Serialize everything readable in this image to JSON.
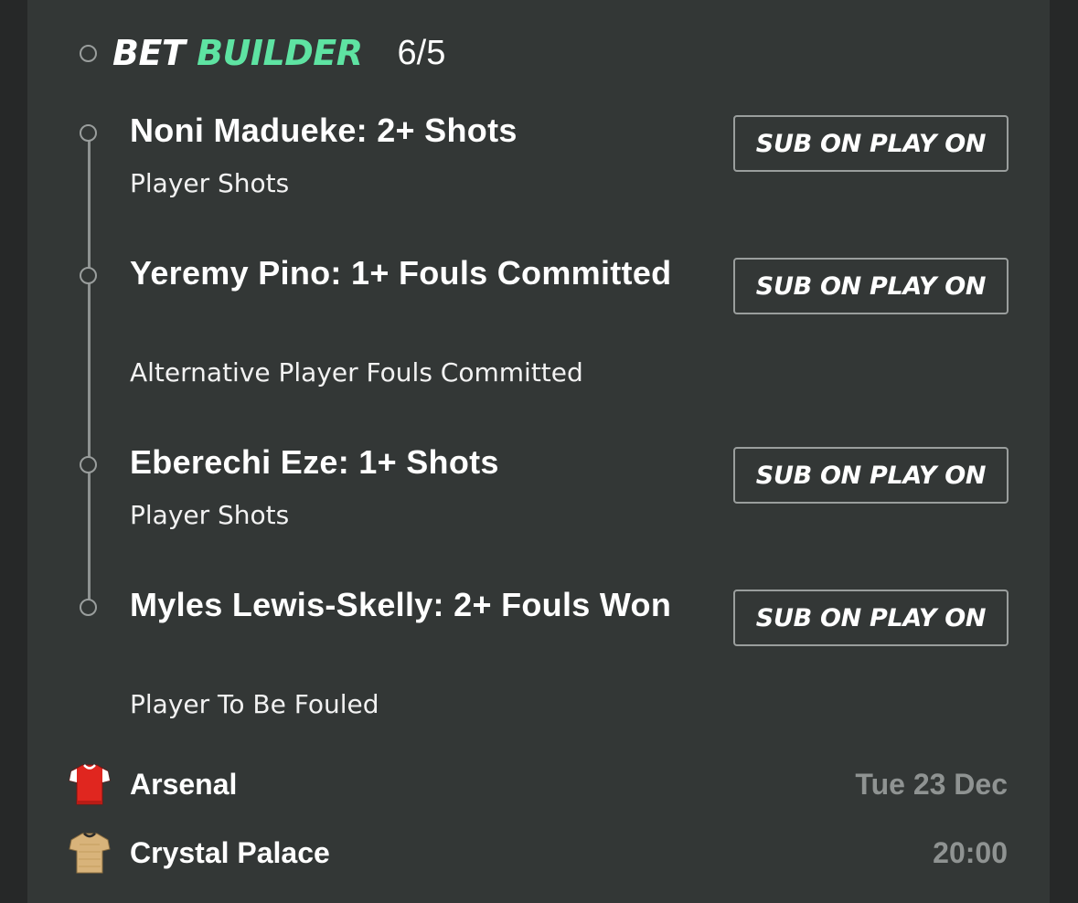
{
  "header": {
    "title_part1": "BET",
    "title_part2": "BUILDER",
    "odds": "6/5"
  },
  "selections": [
    {
      "title": "Noni Madueke: 2+ Shots",
      "market": "Player Shots",
      "button_label": "SUB ON PLAY ON"
    },
    {
      "title": "Yeremy Pino: 1+ Fouls Committed",
      "market": "Alternative Player Fouls Committed",
      "button_label": "SUB ON PLAY ON"
    },
    {
      "title": "Eberechi Eze: 1+ Shots",
      "market": "Player Shots",
      "button_label": "SUB ON PLAY ON"
    },
    {
      "title": "Myles Lewis-Skelly: 2+ Fouls Won",
      "market": "Player To Be Fouled",
      "button_label": "SUB ON PLAY ON"
    }
  ],
  "match": {
    "home_team": "Arsenal",
    "away_team": "Crystal Palace",
    "date": "Tue 23 Dec",
    "time": "20:00"
  },
  "colors": {
    "accent": "#5ee3a2",
    "background": "#333736",
    "home_kit": "#e0261f",
    "away_kit": "#d8b37a"
  }
}
